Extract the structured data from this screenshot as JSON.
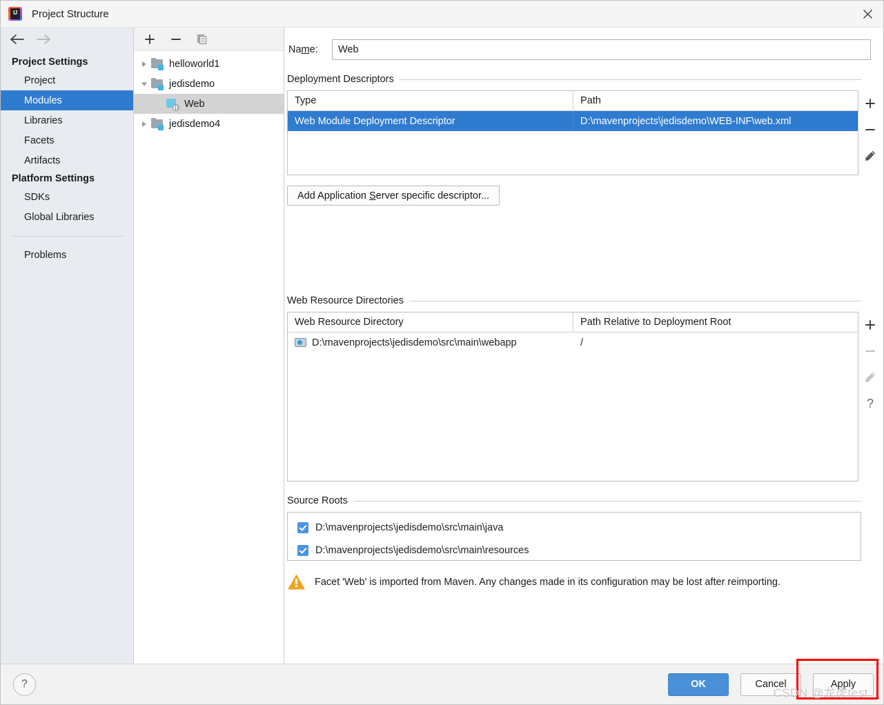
{
  "window": {
    "title": "Project Structure",
    "app_icon": "intellij-idea-icon",
    "close_icon": "close-icon"
  },
  "nav": {
    "back_icon": "arrow-left-icon",
    "forward_icon": "arrow-right-icon"
  },
  "sidebar": {
    "groups": [
      {
        "title": "Project Settings",
        "items": [
          {
            "label": "Project",
            "selected": false
          },
          {
            "label": "Modules",
            "selected": true
          },
          {
            "label": "Libraries",
            "selected": false
          },
          {
            "label": "Facets",
            "selected": false
          },
          {
            "label": "Artifacts",
            "selected": false
          }
        ]
      },
      {
        "title": "Platform Settings",
        "items": [
          {
            "label": "SDKs",
            "selected": false
          },
          {
            "label": "Global Libraries",
            "selected": false
          }
        ]
      }
    ],
    "extra": [
      {
        "label": "Problems",
        "selected": false
      }
    ]
  },
  "tree_toolbar": {
    "add_icon": "plus-icon",
    "remove_icon": "minus-icon",
    "copy_icon": "copy-icon"
  },
  "module_tree": [
    {
      "label": "helloworld1",
      "icon": "module-folder-icon",
      "expanded": false,
      "selected": false,
      "indent": 0
    },
    {
      "label": "jedisdemo",
      "icon": "module-folder-icon",
      "expanded": true,
      "selected": false,
      "indent": 0
    },
    {
      "label": "Web",
      "icon": "web-facet-icon",
      "expanded": null,
      "selected": true,
      "indent": 1
    },
    {
      "label": "jedisdemo4",
      "icon": "module-folder-icon",
      "expanded": false,
      "selected": false,
      "indent": 0
    }
  ],
  "name_field": {
    "label_prefix": "Na",
    "label_mnemonic": "m",
    "label_suffix": "e:",
    "value": "Web"
  },
  "deployment_descriptors": {
    "section_title": "Deployment Descriptors",
    "columns": [
      "Type",
      "Path"
    ],
    "rows": [
      {
        "type": "Web Module Deployment Descriptor",
        "path": "D:\\mavenprojects\\jedisdemo\\WEB-INF\\web.xml",
        "selected": true
      }
    ],
    "tools": [
      {
        "name": "add-descriptor-button",
        "icon": "plus-icon",
        "enabled": true
      },
      {
        "name": "remove-descriptor-button",
        "icon": "minus-icon",
        "enabled": true
      },
      {
        "name": "edit-descriptor-button",
        "icon": "pencil-icon",
        "enabled": true
      }
    ],
    "add_server_descriptor_button": {
      "prefix": "Add Application ",
      "mnemonic": "S",
      "suffix": "erver specific descriptor..."
    }
  },
  "web_resource_directories": {
    "section_title": "Web Resource Directories",
    "columns": [
      "Web Resource Directory",
      "Path Relative to Deployment Root"
    ],
    "rows": [
      {
        "directory": "D:\\mavenprojects\\jedisdemo\\src\\main\\webapp",
        "relative_path": "/",
        "icon": "directory-icon",
        "selected": false
      }
    ],
    "tools": [
      {
        "name": "add-web-resource-button",
        "icon": "plus-icon",
        "enabled": true
      },
      {
        "name": "remove-web-resource-button",
        "icon": "minus-icon",
        "enabled": false
      },
      {
        "name": "edit-web-resource-button",
        "icon": "pencil-icon",
        "enabled": false
      },
      {
        "name": "help-web-resource-button",
        "icon": "question-icon",
        "enabled": true
      }
    ]
  },
  "source_roots": {
    "section_title": "Source Roots",
    "items": [
      {
        "label": "D:\\mavenprojects\\jedisdemo\\src\\main\\java",
        "checked": true
      },
      {
        "label": "D:\\mavenprojects\\jedisdemo\\src\\main\\resources",
        "checked": true
      }
    ]
  },
  "warning": {
    "icon": "warning-triangle-icon",
    "text": "Facet 'Web' is imported from Maven. Any changes made in its configuration may be lost after reimporting."
  },
  "footer": {
    "help_label": "?",
    "ok_label": "OK",
    "cancel_label": "Cancel",
    "apply_label": "Apply",
    "watermark": "CSDN @龙虎test"
  },
  "colors": {
    "selection_blue": "#2f7bd0",
    "primary_button": "#4a90d9",
    "tree_selection_grey": "#d3d3d3",
    "warning_orange": "#f0a321",
    "highlight_red": "#ff0000",
    "folder_badge_cyan": "#40b6e0"
  }
}
